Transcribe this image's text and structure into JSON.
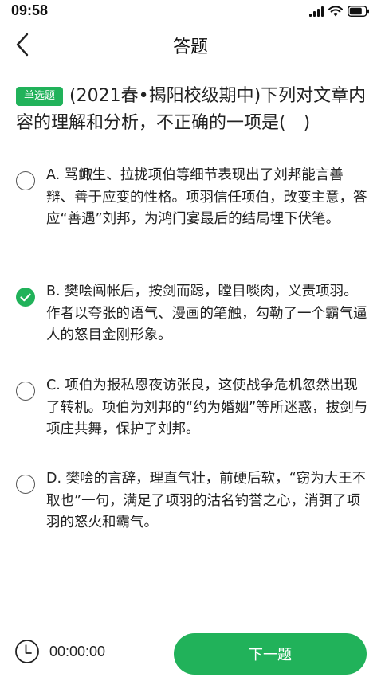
{
  "status_bar": {
    "time": "09:58"
  },
  "nav": {
    "title": "答题"
  },
  "question": {
    "type_badge": "单选题",
    "text": "(2021春•揭阳校级期中)下列对文章内容的理解和分析，不正确的一项是(　)"
  },
  "options": [
    {
      "label": "A. 骂鲰生、拉拢项伯等细节表现出了刘邦能言善辩、善于应变的性格。项羽信任项伯，改变主意，答应“善遇”刘邦，为鸿门宴最后的结局埋下伏笔。",
      "selected": false
    },
    {
      "label": "B. 樊哙闯帐后，按剑而跽，瞠目啖肉，义责项羽。作者以夸张的语气、漫画的笔触，勾勒了一个霸气逼人的怒目金刚形象。",
      "selected": true
    },
    {
      "label": "C. 项伯为报私恩夜访张良，这使战争危机忽然出现了转机。项伯为刘邦的“约为婚姻”等所迷惑，拔剑与项庄共舞，保护了刘邦。",
      "selected": false
    },
    {
      "label": "D. 樊哙的言辞，理直气壮，前硬后软，“窃为大王不取也”一句，满足了项羽的沽名钓誉之心，消弭了项羽的怒火和霸气。",
      "selected": false
    }
  ],
  "footer": {
    "timer": "00:00:00",
    "next_label": "下一题"
  },
  "colors": {
    "accent": "#21b25a"
  },
  "icons": {
    "back": "chevron-left-icon",
    "selected": "check-circle-icon",
    "timer": "clock-icon"
  }
}
